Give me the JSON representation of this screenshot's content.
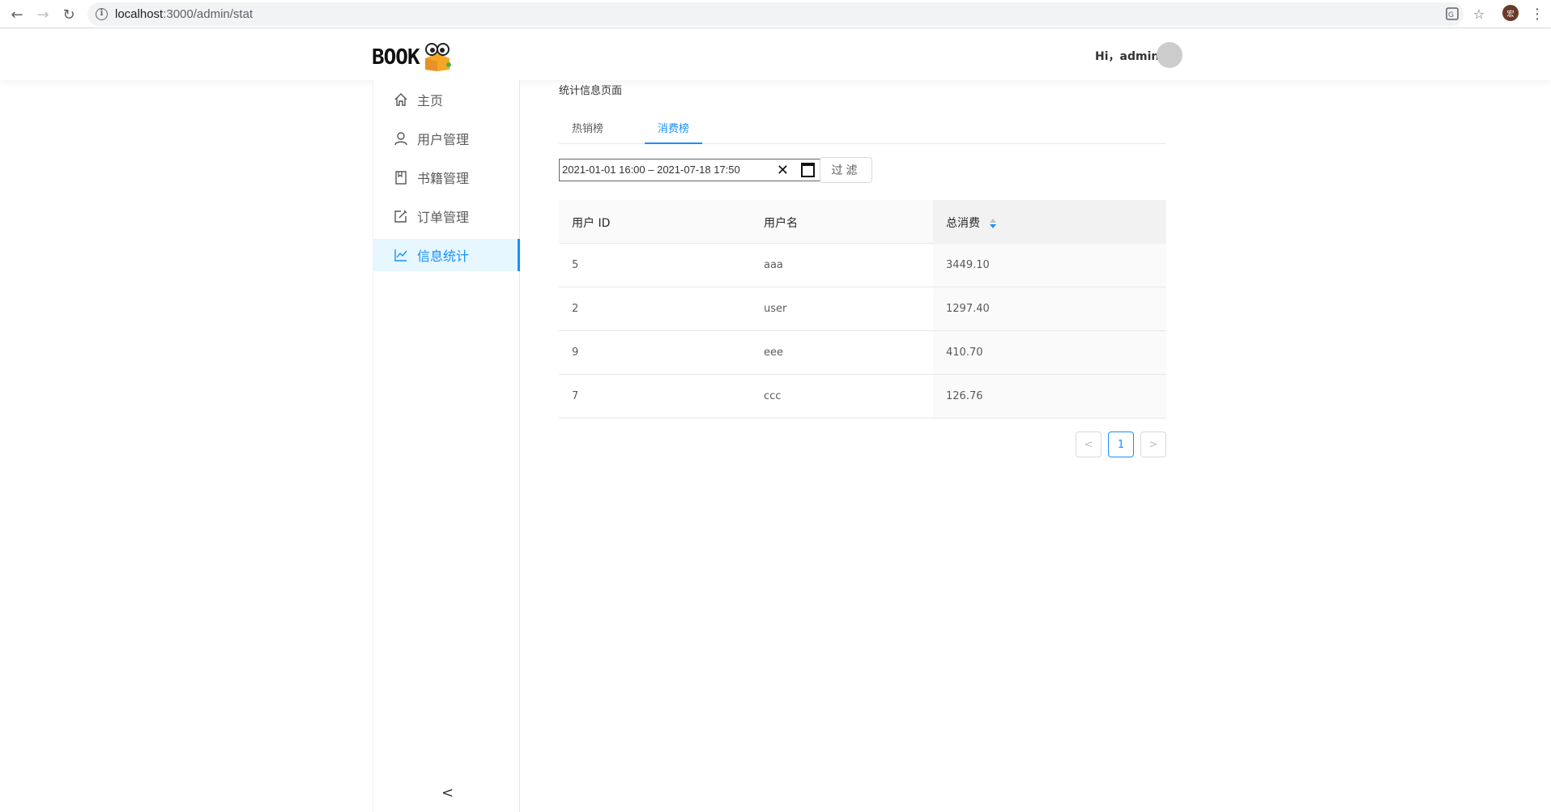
{
  "browser": {
    "url_host": "localhost",
    "url_path": ":3000/admin/stat"
  },
  "header": {
    "logo_text": "BOOK",
    "greeting": "Hi，admin"
  },
  "sidebar": {
    "items": [
      {
        "label": "主页",
        "icon": "home-icon"
      },
      {
        "label": "用户管理",
        "icon": "user-icon"
      },
      {
        "label": "书籍管理",
        "icon": "book-icon"
      },
      {
        "label": "订单管理",
        "icon": "edit-icon"
      },
      {
        "label": "信息统计",
        "icon": "line-chart-icon",
        "active": true
      }
    ],
    "collapse_label": "<"
  },
  "main": {
    "page_title": "统计信息页面",
    "tabs": [
      {
        "label": "热销榜",
        "active": false
      },
      {
        "label": "消费榜",
        "active": true
      }
    ],
    "range": {
      "value": "2021-01-01  16:00 – 2021-07-18  17:50"
    },
    "filter_label": "过滤",
    "table": {
      "columns": [
        "用户 ID",
        "用户名",
        "总消费"
      ],
      "sorted_column": "总消费",
      "rows": [
        {
          "id": "5",
          "name": "aaa",
          "total": "3449.10"
        },
        {
          "id": "2",
          "name": "user",
          "total": "1297.40"
        },
        {
          "id": "9",
          "name": "eee",
          "total": "410.70"
        },
        {
          "id": "7",
          "name": "ccc",
          "total": "126.76"
        }
      ]
    },
    "pagination": {
      "prev": "<",
      "current": "1",
      "next": ">"
    }
  },
  "colors": {
    "accent": "#1890ff",
    "active_bg": "#e6f7ff"
  }
}
